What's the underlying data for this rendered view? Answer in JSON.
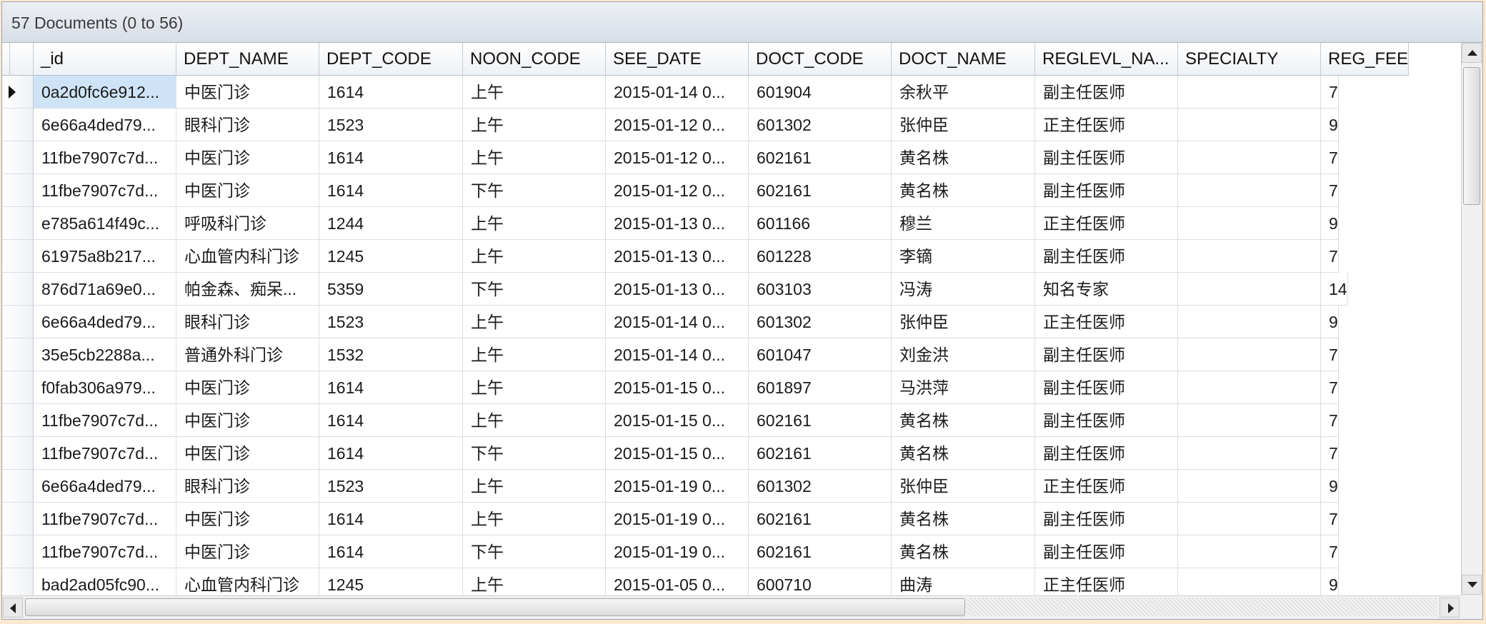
{
  "caption": "57 Documents (0 to 56)",
  "columns": [
    "_id",
    "DEPT_NAME",
    "DEPT_CODE",
    "NOON_CODE",
    "SEE_DATE",
    "DOCT_CODE",
    "DOCT_NAME",
    "REGLEVL_NA...",
    "SPECIALTY",
    "REG_FEE"
  ],
  "rows": [
    [
      "0a2d0fc6e912...",
      "中医门诊",
      "1614",
      "上午",
      "2015-01-14 0...",
      "601904",
      "余秋平",
      "副主任医师",
      "",
      "7"
    ],
    [
      "6e66a4ded79...",
      "眼科门诊",
      "1523",
      "上午",
      "2015-01-12 0...",
      "601302",
      "张仲臣",
      "正主任医师",
      "",
      "9"
    ],
    [
      "11fbe7907c7d...",
      "中医门诊",
      "1614",
      "上午",
      "2015-01-12 0...",
      "602161",
      "黄名株",
      "副主任医师",
      "",
      "7"
    ],
    [
      "11fbe7907c7d...",
      "中医门诊",
      "1614",
      "下午",
      "2015-01-12 0...",
      "602161",
      "黄名株",
      "副主任医师",
      "",
      "7"
    ],
    [
      "e785a614f49c...",
      "呼吸科门诊",
      "1244",
      "上午",
      "2015-01-13 0...",
      "601166",
      "穆兰",
      "正主任医师",
      "",
      "9"
    ],
    [
      "61975a8b217...",
      "心血管内科门诊",
      "1245",
      "上午",
      "2015-01-13 0...",
      "601228",
      "李镝",
      "副主任医师",
      "",
      "7"
    ],
    [
      "876d71a69e0...",
      "帕金森、痴呆...",
      "5359",
      "下午",
      "2015-01-13 0...",
      "603103",
      "冯涛",
      "知名专家",
      "",
      "14"
    ],
    [
      "6e66a4ded79...",
      "眼科门诊",
      "1523",
      "上午",
      "2015-01-14 0...",
      "601302",
      "张仲臣",
      "正主任医师",
      "",
      "9"
    ],
    [
      "35e5cb2288a...",
      "普通外科门诊",
      "1532",
      "上午",
      "2015-01-14 0...",
      "601047",
      "刘金洪",
      "副主任医师",
      "",
      "7"
    ],
    [
      "f0fab306a979...",
      "中医门诊",
      "1614",
      "上午",
      "2015-01-15 0...",
      "601897",
      "马洪萍",
      "副主任医师",
      "",
      "7"
    ],
    [
      "11fbe7907c7d...",
      "中医门诊",
      "1614",
      "上午",
      "2015-01-15 0...",
      "602161",
      "黄名株",
      "副主任医师",
      "",
      "7"
    ],
    [
      "11fbe7907c7d...",
      "中医门诊",
      "1614",
      "下午",
      "2015-01-15 0...",
      "602161",
      "黄名株",
      "副主任医师",
      "",
      "7"
    ],
    [
      "6e66a4ded79...",
      "眼科门诊",
      "1523",
      "上午",
      "2015-01-19 0...",
      "601302",
      "张仲臣",
      "正主任医师",
      "",
      "9"
    ],
    [
      "11fbe7907c7d...",
      "中医门诊",
      "1614",
      "上午",
      "2015-01-19 0...",
      "602161",
      "黄名株",
      "副主任医师",
      "",
      "7"
    ],
    [
      "11fbe7907c7d...",
      "中医门诊",
      "1614",
      "下午",
      "2015-01-19 0...",
      "602161",
      "黄名株",
      "副主任医师",
      "",
      "7"
    ],
    [
      "bad2ad05fc90...",
      "心血管内科门诊",
      "1245",
      "上午",
      "2015-01-05 0...",
      "600710",
      "曲涛",
      "正主任医师",
      "",
      "9"
    ]
  ],
  "selected_row": 0,
  "colors": {
    "selection": "#cfe3f7",
    "background": "#fce7cf"
  }
}
